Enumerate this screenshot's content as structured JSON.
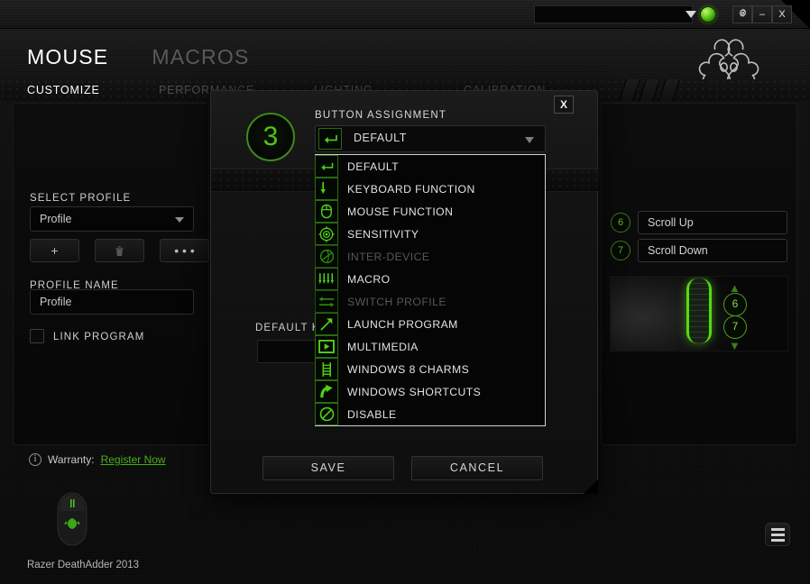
{
  "titlebar": {
    "address_value": "",
    "settings_icon": "gear-icon",
    "minimize_label": "–",
    "close_label": "X",
    "status_indicator": "connected-orb"
  },
  "header": {
    "main_tabs": [
      {
        "label": "MOUSE",
        "active": true
      },
      {
        "label": "MACROS",
        "active": false
      }
    ],
    "brand": "razer-logo"
  },
  "sub_tabs": [
    {
      "label": "CUSTOMIZE",
      "active": true
    },
    {
      "label": "PERFORMANCE",
      "active": false
    },
    {
      "label": "LIGHTING",
      "active": false
    },
    {
      "label": "CALIBRATION",
      "active": false
    }
  ],
  "left_panel": {
    "select_profile_label": "SELECT PROFILE",
    "profile_value": "Profile",
    "add_button": "+",
    "delete_button": "trash-icon",
    "more_button": "• • •",
    "profile_name_label": "PROFILE NAME",
    "profile_name_value": "Profile",
    "link_program_label": "LINK PROGRAM",
    "link_program_checked": false
  },
  "right_panel": {
    "buttons": [
      {
        "number": "6",
        "assignment": "Scroll Up"
      },
      {
        "number": "7",
        "assignment": "Scroll Down"
      }
    ],
    "wheel_numbers": [
      "6",
      "7"
    ]
  },
  "footer": {
    "warranty_label": "Warranty:",
    "warranty_link": "Register Now",
    "device_name": "Razer DeathAdder 2013",
    "menu_icon": "hamburger-icon"
  },
  "modal": {
    "close_label": "X",
    "button_number": "3",
    "assignment_title": "BUTTON ASSIGNMENT",
    "selected_value": "DEFAULT",
    "selected_icon": "default-arrow-icon",
    "default_key_label": "DEFAULT K",
    "default_key_value": "",
    "save_label": "SAVE",
    "cancel_label": "CANCEL",
    "dropdown_items": [
      {
        "label": "DEFAULT",
        "icon": "default-arrow-icon",
        "disabled": false
      },
      {
        "label": "KEYBOARD FUNCTION",
        "icon": "down-arrow-icon",
        "disabled": false
      },
      {
        "label": "MOUSE FUNCTION",
        "icon": "mouse-icon",
        "disabled": false
      },
      {
        "label": "SENSITIVITY",
        "icon": "target-icon",
        "disabled": false
      },
      {
        "label": "INTER-DEVICE",
        "icon": "inter-device-icon",
        "disabled": true
      },
      {
        "label": "MACRO",
        "icon": "macro-waveform-icon",
        "disabled": false
      },
      {
        "label": "SWITCH PROFILE",
        "icon": "swap-arrows-icon",
        "disabled": true
      },
      {
        "label": "LAUNCH PROGRAM",
        "icon": "diagonal-arrow-icon",
        "disabled": false
      },
      {
        "label": "MULTIMEDIA",
        "icon": "play-box-icon",
        "disabled": false
      },
      {
        "label": "WINDOWS 8 CHARMS",
        "icon": "charms-ladder-icon",
        "disabled": false
      },
      {
        "label": "WINDOWS SHORTCUTS",
        "icon": "curved-arrow-icon",
        "disabled": false
      },
      {
        "label": "DISABLE",
        "icon": "disable-slash-icon",
        "disabled": false
      }
    ]
  },
  "colors": {
    "accent_green": "#52c41a",
    "bright_green": "#5bd617",
    "disabled_text": "#575757",
    "panel_bg": "#0a0a0a"
  }
}
